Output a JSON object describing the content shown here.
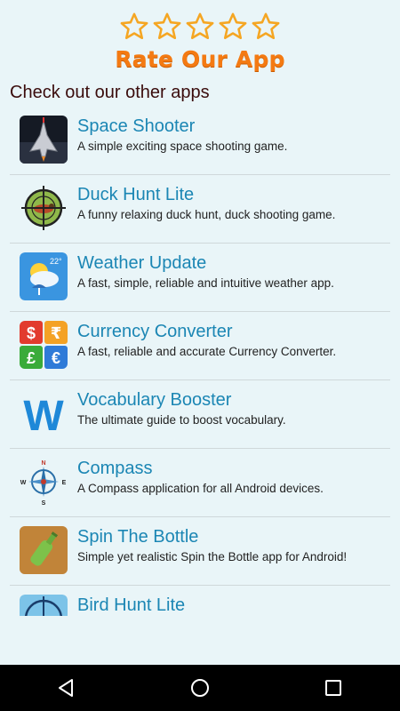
{
  "header": {
    "rating_stars": 5,
    "rate_label": "Rate Our App",
    "star_color": "#f5a623"
  },
  "section_title": "Check out our other apps",
  "apps": [
    {
      "name": "Space Shooter",
      "description": "A simple exciting space shooting game.",
      "icon": "space-shooter-icon"
    },
    {
      "name": "Duck Hunt Lite",
      "description": "A funny relaxing duck hunt, duck shooting game.",
      "icon": "duck-hunt-icon"
    },
    {
      "name": "Weather Update",
      "description": "A fast, simple, reliable and intuitive weather app.",
      "icon": "weather-icon",
      "icon_text": "22°"
    },
    {
      "name": "Currency Converter",
      "description": "A fast, reliable and accurate Currency Converter.",
      "icon": "currency-icon",
      "icon_symbols": [
        "$",
        "₹",
        "£",
        "€"
      ]
    },
    {
      "name": "Vocabulary Booster",
      "description": "The ultimate guide to boost vocabulary.",
      "icon": "vocabulary-icon",
      "icon_text": "W"
    },
    {
      "name": "Compass",
      "description": "A Compass application for all Android devices.",
      "icon": "compass-icon",
      "icon_letters": [
        "N",
        "E",
        "S",
        "W"
      ]
    },
    {
      "name": "Spin The Bottle",
      "description": "Simple yet realistic Spin the Bottle app for Android!",
      "icon": "bottle-icon"
    },
    {
      "name": "Bird Hunt Lite",
      "description": "",
      "icon": "bird-hunt-icon"
    }
  ],
  "navigation": {
    "back": "back-icon",
    "home": "home-icon",
    "recents": "recents-icon"
  },
  "colors": {
    "background": "#e9f5f8",
    "accent_orange": "#f47a12",
    "app_name": "#1b86b4",
    "heading": "#3a0c0c"
  }
}
